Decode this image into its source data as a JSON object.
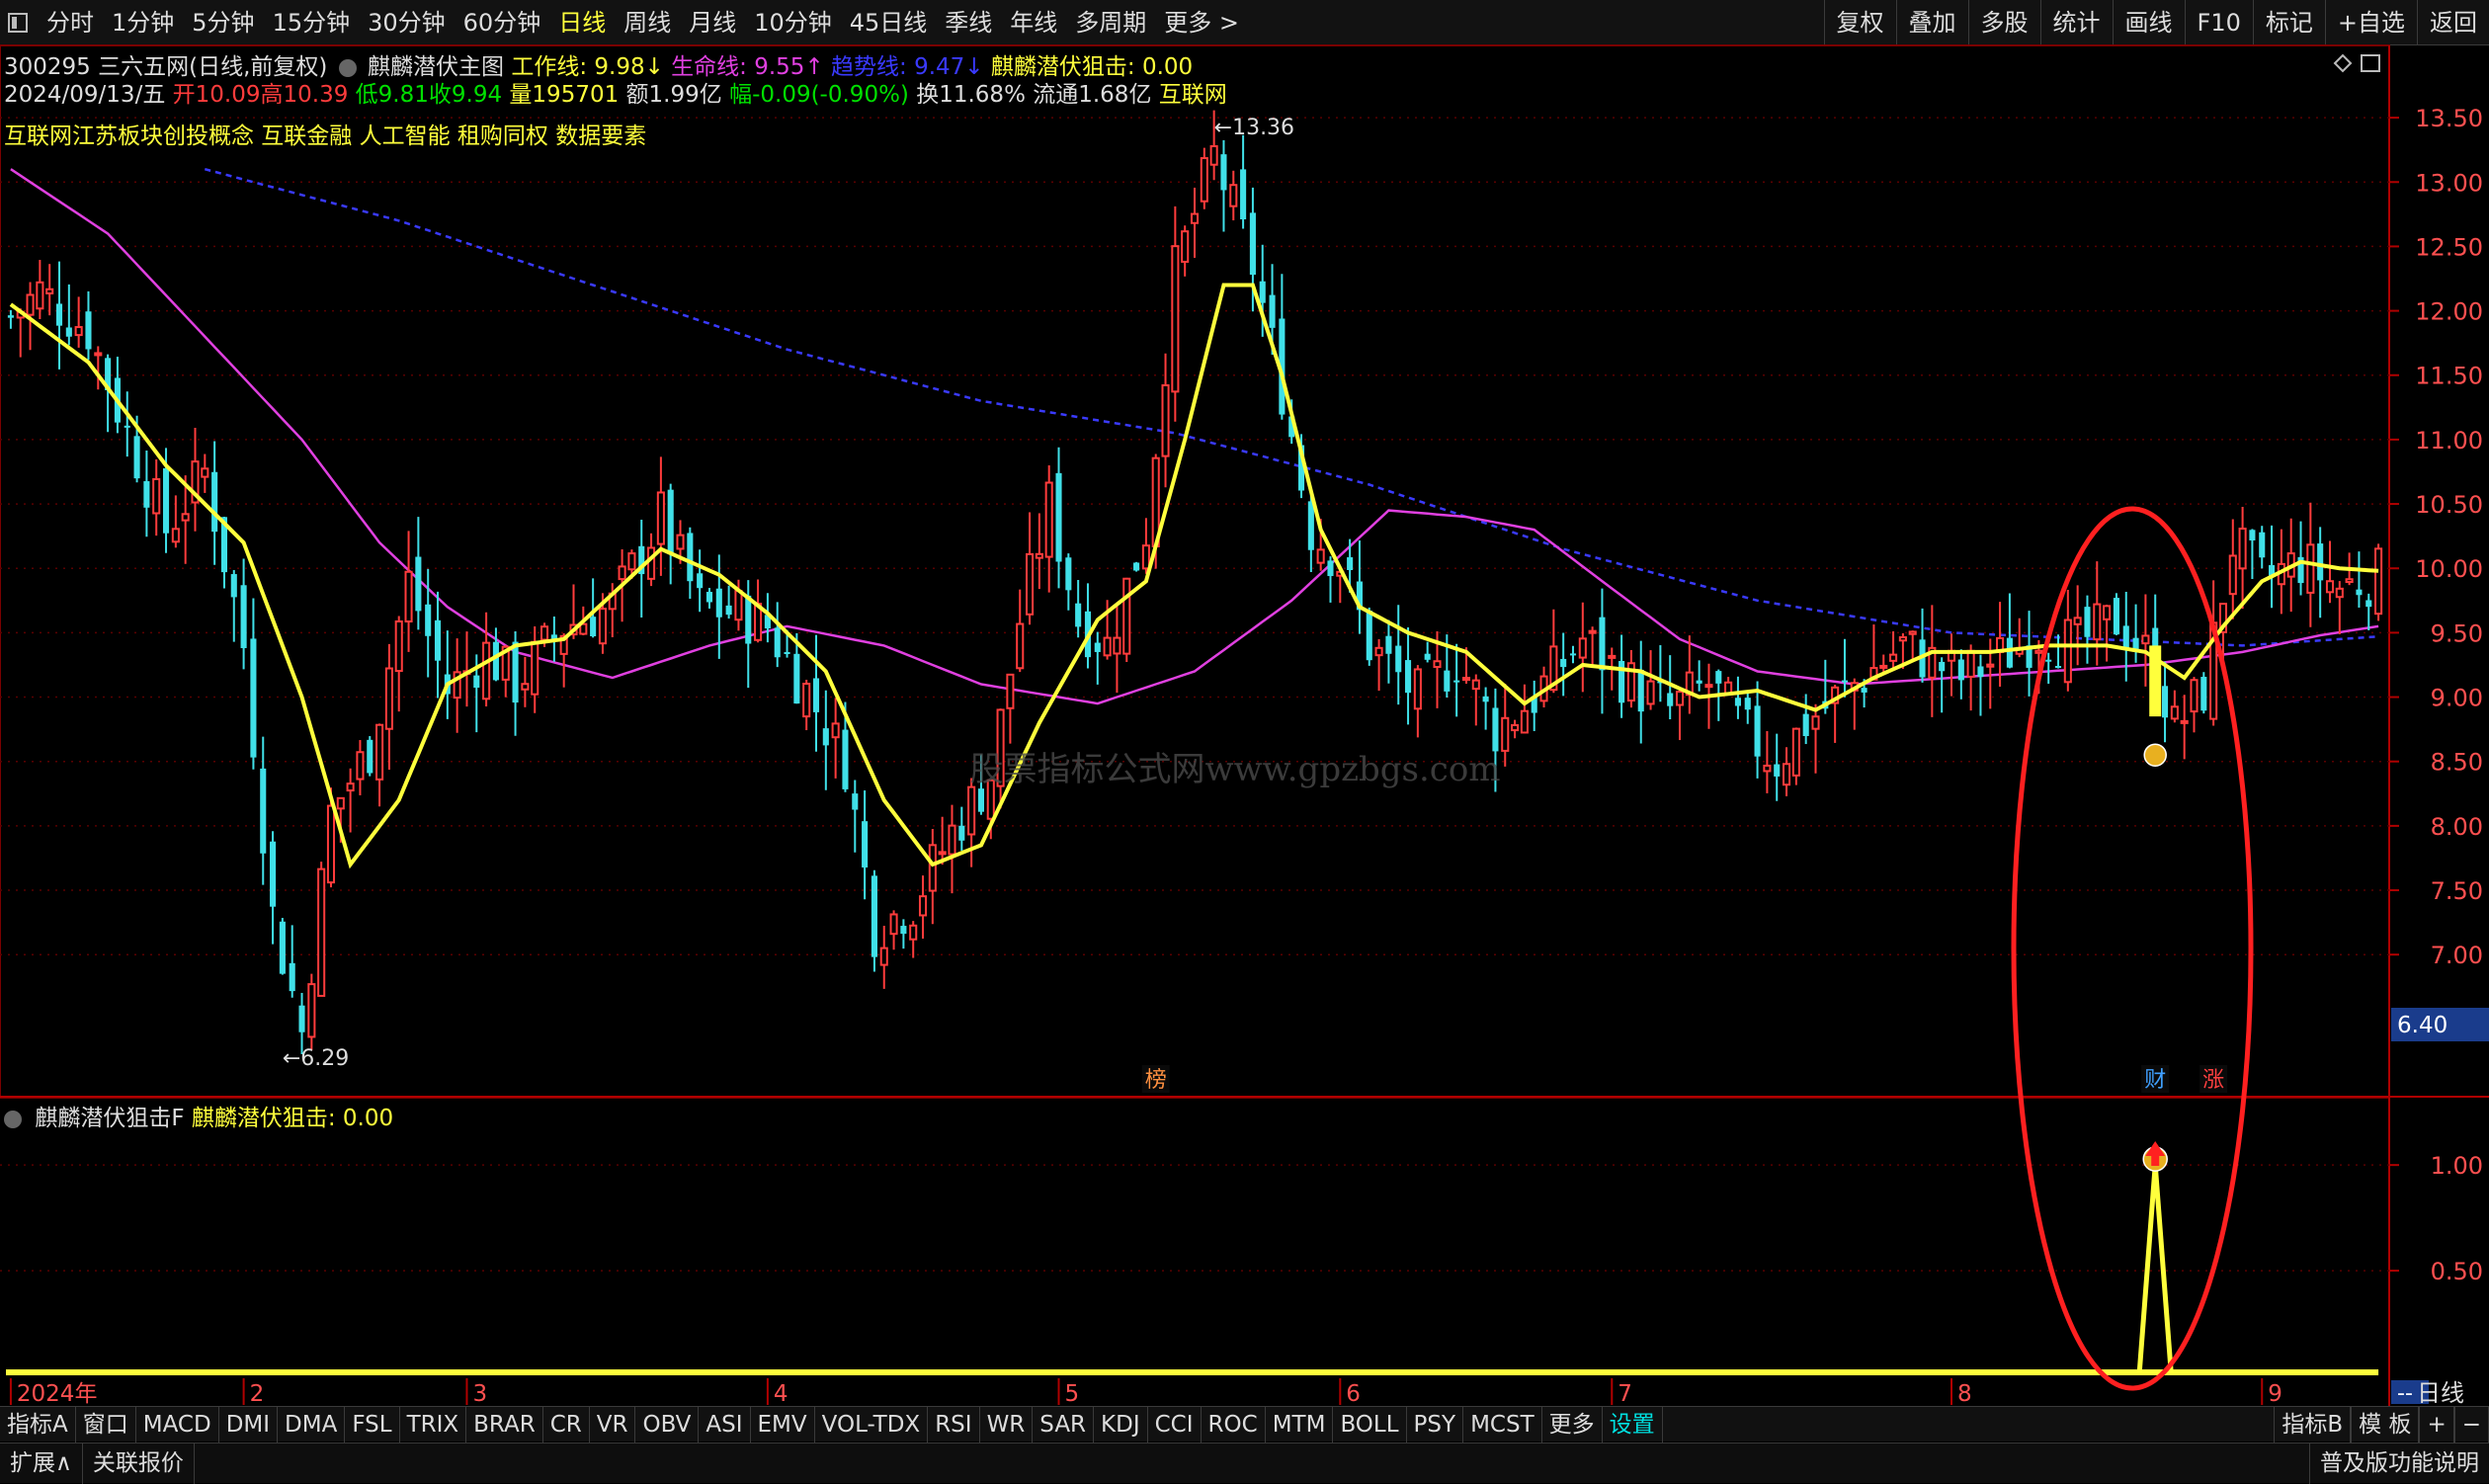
{
  "toolbar": {
    "periods": [
      "分时",
      "1分钟",
      "5分钟",
      "15分钟",
      "30分钟",
      "60分钟",
      "日线",
      "周线",
      "月线",
      "10分钟",
      "45日线",
      "季线",
      "年线",
      "多周期",
      "更多 >"
    ],
    "active_period": "日线",
    "right_tools": [
      "复权",
      "叠加",
      "多股",
      "统计",
      "画线",
      "F10",
      "标记",
      "+自选",
      "返回"
    ]
  },
  "stock": {
    "code_name": "300295 三六五网(日线,前复权)",
    "indicator_name": "麒麟潜伏主图",
    "work_line": "工作线: 9.98↓",
    "life_line": "生命线: 9.55↑",
    "trend_line": "趋势线: 9.47↓",
    "snipe": "麒麟潜伏狙击: 0.00",
    "date": "2024/09/13/五",
    "open": "开10.09",
    "high": "高10.39",
    "low": "低9.81",
    "close": "收9.94",
    "volume": "量195701",
    "amount": "额1.99亿",
    "change": "幅-0.09(-0.90%)",
    "turnover": "换11.68%",
    "float": "流通1.68亿",
    "industry": "互联网",
    "concepts": "互联网江苏板块创投概念 互联金融 人工智能 租购同权 数据要素"
  },
  "colors": {
    "up": "#ff3c3c",
    "down": "#40e0e8",
    "work_line": "#ffff3c",
    "life_line": "#e040e0",
    "trend_line": "#3a3aff",
    "ellipse": "#ff2020"
  },
  "chart_data": {
    "type": "candlestick",
    "y_ticks": [
      13.5,
      13.0,
      12.5,
      12.0,
      11.5,
      11.0,
      10.5,
      10.0,
      9.5,
      9.0,
      8.5,
      8.0,
      7.5,
      7.0
    ],
    "y_tick_labels": [
      "13.50",
      "13.00",
      "12.50",
      "12.00",
      "11.50",
      "11.00",
      "10.50",
      "10.00",
      "9.50",
      "9.00",
      "8.50",
      "8.00",
      "7.50",
      "7.00"
    ],
    "ylim": [
      6.05,
      13.8
    ],
    "current_price_label": "6.40",
    "high_annotation": "13.36",
    "low_annotation": "6.29",
    "x_labels": [
      "2024年",
      "2",
      "3",
      "4",
      "5",
      "6",
      "7",
      "8",
      "9"
    ],
    "x_label_index": [
      0,
      24,
      47,
      78,
      108,
      137,
      165,
      200,
      232
    ],
    "n_bars": 245,
    "candles_keypoints": [
      [
        0,
        11.95
      ],
      [
        3,
        12.15
      ],
      [
        8,
        11.85
      ],
      [
        12,
        11.05
      ],
      [
        16,
        10.3
      ],
      [
        20,
        10.75
      ],
      [
        24,
        9.4
      ],
      [
        27,
        7.3
      ],
      [
        30,
        6.4
      ],
      [
        33,
        8.1
      ],
      [
        37,
        8.6
      ],
      [
        41,
        9.9
      ],
      [
        45,
        9.05
      ],
      [
        49,
        9.35
      ],
      [
        52,
        9.1
      ],
      [
        57,
        9.55
      ],
      [
        62,
        9.7
      ],
      [
        67,
        10.4
      ],
      [
        71,
        9.7
      ],
      [
        75,
        9.65
      ],
      [
        78,
        9.55
      ],
      [
        82,
        9.05
      ],
      [
        86,
        8.5
      ],
      [
        89,
        7.2
      ],
      [
        93,
        7.4
      ],
      [
        97,
        7.95
      ],
      [
        101,
        8.4
      ],
      [
        104,
        9.6
      ],
      [
        107,
        10.5
      ],
      [
        110,
        9.6
      ],
      [
        113,
        9.4
      ],
      [
        117,
        10.3
      ],
      [
        120,
        12.3
      ],
      [
        124,
        13.2
      ],
      [
        128,
        12.35
      ],
      [
        131,
        11.4
      ],
      [
        134,
        10.3
      ],
      [
        137,
        10.05
      ],
      [
        140,
        9.4
      ],
      [
        145,
        9.0
      ],
      [
        149,
        9.3
      ],
      [
        153,
        8.75
      ],
      [
        157,
        9.0
      ],
      [
        162,
        9.45
      ],
      [
        167,
        9.1
      ],
      [
        171,
        8.9
      ],
      [
        175,
        9.1
      ],
      [
        179,
        8.7
      ],
      [
        182,
        8.5
      ],
      [
        185,
        8.8
      ],
      [
        190,
        9.1
      ],
      [
        195,
        9.4
      ],
      [
        201,
        9.15
      ],
      [
        205,
        9.3
      ],
      [
        209,
        9.5
      ],
      [
        213,
        9.4
      ],
      [
        217,
        9.6
      ],
      [
        221,
        9.25
      ],
      [
        223,
        8.75
      ],
      [
        226,
        9.05
      ],
      [
        229,
        10.2
      ],
      [
        232,
        9.9
      ],
      [
        236,
        10.05
      ],
      [
        240,
        9.85
      ],
      [
        244,
        9.94
      ]
    ],
    "work_line_keypoints": [
      [
        0,
        12.05
      ],
      [
        8,
        11.6
      ],
      [
        16,
        10.8
      ],
      [
        24,
        10.2
      ],
      [
        30,
        9.0
      ],
      [
        35,
        7.7
      ],
      [
        40,
        8.2
      ],
      [
        45,
        9.1
      ],
      [
        52,
        9.4
      ],
      [
        57,
        9.45
      ],
      [
        62,
        9.8
      ],
      [
        67,
        10.15
      ],
      [
        73,
        9.95
      ],
      [
        78,
        9.65
      ],
      [
        84,
        9.2
      ],
      [
        90,
        8.2
      ],
      [
        95,
        7.7
      ],
      [
        100,
        7.85
      ],
      [
        106,
        8.8
      ],
      [
        112,
        9.6
      ],
      [
        117,
        9.9
      ],
      [
        121,
        11.0
      ],
      [
        125,
        12.2
      ],
      [
        128,
        12.2
      ],
      [
        131,
        11.5
      ],
      [
        135,
        10.3
      ],
      [
        139,
        9.7
      ],
      [
        144,
        9.5
      ],
      [
        150,
        9.35
      ],
      [
        156,
        8.95
      ],
      [
        162,
        9.25
      ],
      [
        168,
        9.2
      ],
      [
        174,
        9.0
      ],
      [
        180,
        9.05
      ],
      [
        186,
        8.9
      ],
      [
        192,
        9.15
      ],
      [
        198,
        9.35
      ],
      [
        204,
        9.35
      ],
      [
        210,
        9.4
      ],
      [
        216,
        9.4
      ],
      [
        220,
        9.35
      ],
      [
        224,
        9.15
      ],
      [
        228,
        9.55
      ],
      [
        232,
        9.9
      ],
      [
        236,
        10.05
      ],
      [
        240,
        10.0
      ],
      [
        244,
        9.98
      ]
    ],
    "life_line_keypoints": [
      [
        0,
        13.1
      ],
      [
        10,
        12.6
      ],
      [
        20,
        11.8
      ],
      [
        30,
        11.0
      ],
      [
        38,
        10.2
      ],
      [
        45,
        9.7
      ],
      [
        52,
        9.35
      ],
      [
        62,
        9.15
      ],
      [
        72,
        9.4
      ],
      [
        80,
        9.55
      ],
      [
        90,
        9.4
      ],
      [
        100,
        9.1
      ],
      [
        112,
        8.95
      ],
      [
        122,
        9.2
      ],
      [
        132,
        9.75
      ],
      [
        142,
        10.45
      ],
      [
        150,
        10.4
      ],
      [
        157,
        10.3
      ],
      [
        164,
        9.9
      ],
      [
        172,
        9.45
      ],
      [
        180,
        9.2
      ],
      [
        190,
        9.1
      ],
      [
        200,
        9.15
      ],
      [
        210,
        9.2
      ],
      [
        220,
        9.25
      ],
      [
        230,
        9.35
      ],
      [
        238,
        9.48
      ],
      [
        244,
        9.55
      ]
    ],
    "trend_line_keypoints": [
      [
        20,
        13.1
      ],
      [
        40,
        12.7
      ],
      [
        60,
        12.2
      ],
      [
        80,
        11.7
      ],
      [
        100,
        11.3
      ],
      [
        120,
        11.05
      ],
      [
        140,
        10.65
      ],
      [
        160,
        10.15
      ],
      [
        180,
        9.75
      ],
      [
        200,
        9.5
      ],
      [
        215,
        9.45
      ],
      [
        230,
        9.4
      ],
      [
        244,
        9.47
      ]
    ],
    "sub": {
      "y_ticks": [
        1.0,
        0.5
      ],
      "y_tick_labels": [
        "1.00",
        "0.50"
      ],
      "ylim": [
        0,
        1.3
      ],
      "signal_index": 221,
      "signal_value": 1.0
    },
    "markers": [
      {
        "label": "榜",
        "index": 118,
        "color": "#ff9040"
      },
      {
        "label": "财",
        "index": 221,
        "color": "#40a0ff"
      },
      {
        "label": "涨",
        "index": 227,
        "color": "#ff4040"
      }
    ]
  },
  "sub_panel": {
    "name": "麒麟潜伏狙击F",
    "value": "麒麟潜伏狙击: 0.00"
  },
  "watermark": "股票指标公式网www.gpzbgs.com",
  "indicator_tabs": [
    "指标A",
    "窗口",
    "MACD",
    "DMI",
    "DMA",
    "FSL",
    "TRIX",
    "BRAR",
    "CR",
    "VR",
    "OBV",
    "ASI",
    "EMV",
    "VOL-TDX",
    "RSI",
    "WR",
    "SAR",
    "KDJ",
    "CCI",
    "ROC",
    "MTM",
    "BOLL",
    "PSY",
    "MCST",
    "更多",
    "设置"
  ],
  "indicator_tabs_right": [
    "指标B",
    "模 板",
    "+",
    "−"
  ],
  "timeframe_label": "日线",
  "dash_label": "--",
  "bottom": {
    "expand": "扩展∧",
    "related": "关联报价",
    "right": "普及版功能说明"
  }
}
